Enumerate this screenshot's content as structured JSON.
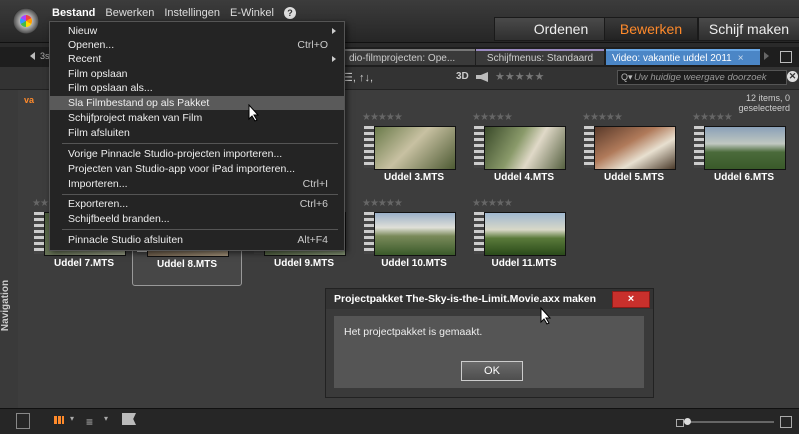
{
  "menubar": {
    "items": [
      "Bestand",
      "Bewerken",
      "Instellingen",
      "E-Winkel"
    ]
  },
  "modes": {
    "ordenen": "Ordenen",
    "bewerken": "Bewerken",
    "schijf": "Schijf maken"
  },
  "colors": {
    "accent": "#ff8a2b",
    "tab_active": "#4b86c6",
    "close_red": "#c9302c"
  },
  "tabs": {
    "first_fragment": "3s",
    "films": "dio-filmprojecten: Ope...",
    "schijf": "Schijfmenus: Standaard",
    "video": "Video: vakantie uddel 2011",
    "video_close": "×"
  },
  "toolbar": {
    "sort": "☰, ↑↓,",
    "threed": "3D",
    "stars": "★★★★★",
    "search_placeholder": "Uw huidige weergave doorzoek"
  },
  "library": {
    "items_info": "12 items, 0 geselecteerd",
    "nav_label": "Navigation",
    "row_fragment": "va",
    "clips": [
      {
        "name": "Uddel 3.MTS"
      },
      {
        "name": "Uddel 4.MTS"
      },
      {
        "name": "Uddel 5.MTS"
      },
      {
        "name": "Uddel 6.MTS"
      },
      {
        "name": "Uddel 7.MTS"
      },
      {
        "name": "Uddel 8.MTS"
      },
      {
        "name": "Uddel 9.MTS"
      },
      {
        "name": "Uddel 10.MTS"
      },
      {
        "name": "Uddel 11.MTS"
      }
    ]
  },
  "menu": {
    "items": [
      {
        "label": "Nieuw",
        "shortcut": ""
      },
      {
        "label": "Openen...",
        "shortcut": "Ctrl+O"
      },
      {
        "label": "Recent",
        "shortcut": ""
      },
      {
        "label": "Film opslaan",
        "shortcut": ""
      },
      {
        "label": "Film opslaan als...",
        "shortcut": ""
      },
      {
        "label": "Sla Filmbestand op als Pakket",
        "shortcut": ""
      },
      {
        "label": "Schijfproject maken van Film",
        "shortcut": ""
      },
      {
        "label": "Film afsluiten",
        "shortcut": ""
      },
      {
        "label": "Vorige Pinnacle Studio-projecten importeren...",
        "shortcut": ""
      },
      {
        "label": "Projecten van Studio-app voor iPad importeren...",
        "shortcut": ""
      },
      {
        "label": "Importeren...",
        "shortcut": "Ctrl+I"
      },
      {
        "label": "Exporteren...",
        "shortcut": "Ctrl+6"
      },
      {
        "label": "Schijfbeeld branden...",
        "shortcut": ""
      },
      {
        "label": "Pinnacle Studio afsluiten",
        "shortcut": "Alt+F4"
      }
    ]
  },
  "dialog": {
    "title": "Projectpakket The-Sky-is-the-Limit.Movie.axx maken",
    "close": "×",
    "message": "Het projectpakket is gemaakt.",
    "ok": "OK"
  }
}
